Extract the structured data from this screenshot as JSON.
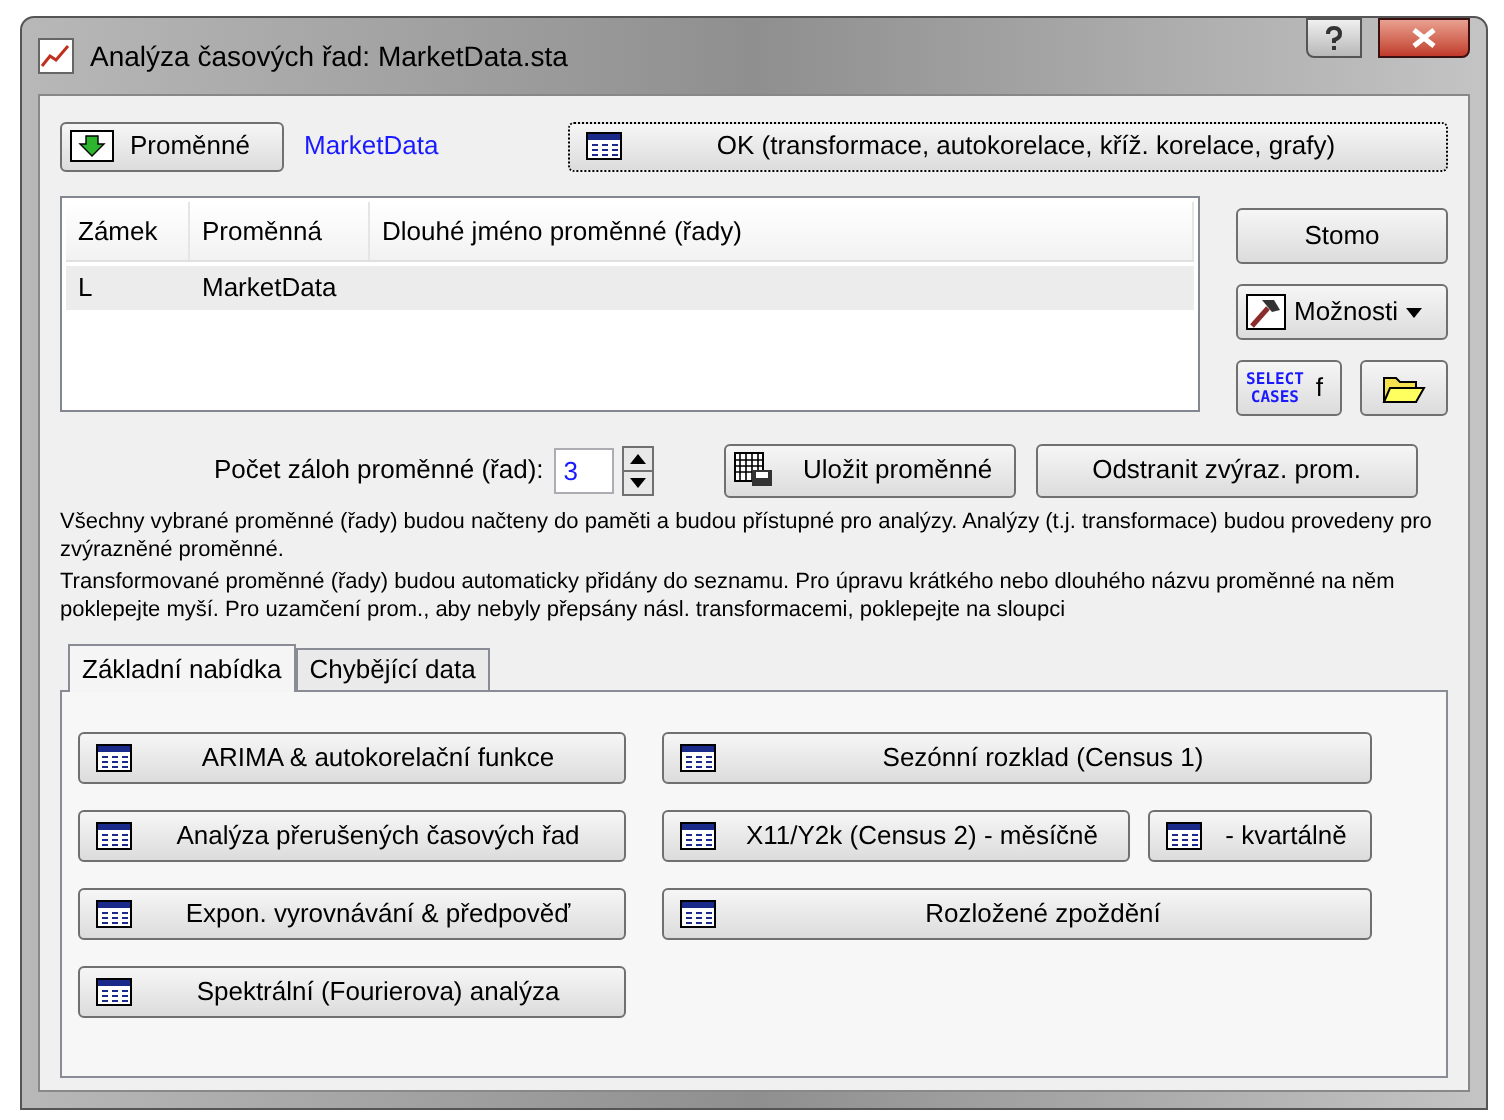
{
  "window": {
    "title": "Analýza časových řad: MarketData.sta"
  },
  "variables_button": "Proměnné",
  "dataset_link": "MarketData",
  "ok_button": "OK (transformace, autokorelace, kříž. korelace, grafy)",
  "table": {
    "columns": [
      "Zámek",
      "Proměnná",
      "Dlouhé jméno proměnné (řady)"
    ],
    "rows": [
      {
        "cells": [
          "L",
          "MarketData",
          ""
        ],
        "selected": true
      }
    ]
  },
  "side_buttons": {
    "cancel": "Stomo",
    "options": "Možnosti",
    "select_cases": [
      "SELECT",
      "CASES"
    ],
    "select_cases_f": "f"
  },
  "backups": {
    "label": "Počet záloh proměnné (řad):",
    "value": "3"
  },
  "save_button": "Uložit proměnné",
  "remove_button": "Odstranit zvýraz. prom.",
  "info": [
    "Všechny vybrané proměnné (řady) budou načteny do paměti a budou přístupné pro analýzy. Analýzy (t.j. transformace) budou provedeny pro zvýrazněné proměnné.",
    "Transformované proměnné (řady) budou automaticky přidány do seznamu. Pro úpravu krátkého nebo dlouhého názvu proměnné na něm poklepejte myší. Pro uzamčení prom., aby nebyly přepsány násl. transformacemi, poklepejte na sloupci"
  ],
  "tabs": [
    {
      "label": "Základní nabídka",
      "selected": true
    },
    {
      "label": "Chybějící data",
      "selected": false
    }
  ],
  "analysis_buttons": {
    "left": [
      "ARIMA & autokorelační funkce",
      "Analýza přerušených časových řad",
      "Expon. vyrovnávání & předpověď",
      "Spektrální (Fourierova) analýza"
    ],
    "right": [
      [
        "Sezónní rozklad (Census 1)"
      ],
      [
        "X11/Y2k (Census 2) - měsíčně",
        "- kvartálně"
      ],
      [
        "Rozložené zpoždění"
      ]
    ]
  }
}
